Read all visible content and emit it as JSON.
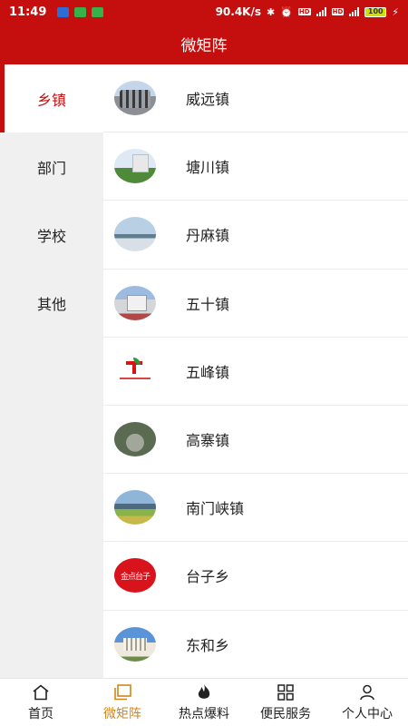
{
  "status_bar": {
    "time": "11:49",
    "network_speed": "90.4K/s",
    "network_type_1": "4G",
    "network_type_2": "4G",
    "battery": "100"
  },
  "header": {
    "title": "微矩阵"
  },
  "sidebar": {
    "items": [
      {
        "label": "乡镇",
        "active": true
      },
      {
        "label": "部门",
        "active": false
      },
      {
        "label": "学校",
        "active": false
      },
      {
        "label": "其他",
        "active": false
      }
    ]
  },
  "list": {
    "items": [
      {
        "label": "威远镇",
        "icon": "town-photo-icon"
      },
      {
        "label": "塘川镇",
        "icon": "town-photo-icon"
      },
      {
        "label": "丹麻镇",
        "icon": "town-photo-icon"
      },
      {
        "label": "五十镇",
        "icon": "town-photo-icon"
      },
      {
        "label": "五峰镇",
        "icon": "town-logo-icon"
      },
      {
        "label": "高寨镇",
        "icon": "town-photo-icon"
      },
      {
        "label": "南门峡镇",
        "icon": "town-photo-icon"
      },
      {
        "label": "台子乡",
        "icon": "calligraphy-logo-icon",
        "logo_text": "金点台子"
      },
      {
        "label": "东和乡",
        "icon": "town-photo-icon"
      }
    ]
  },
  "bottom_nav": {
    "items": [
      {
        "label": "首页",
        "icon": "home-icon",
        "active": false
      },
      {
        "label": "微矩阵",
        "icon": "matrix-icon",
        "active": true
      },
      {
        "label": "热点爆料",
        "icon": "fire-icon",
        "active": false
      },
      {
        "label": "便民服务",
        "icon": "grid-icon",
        "active": false
      },
      {
        "label": "个人中心",
        "icon": "user-icon",
        "active": false
      }
    ]
  },
  "colors": {
    "brand_red": "#c50f0f",
    "active_nav": "#d1861a",
    "sidebar_bg": "#f0f0f0"
  }
}
